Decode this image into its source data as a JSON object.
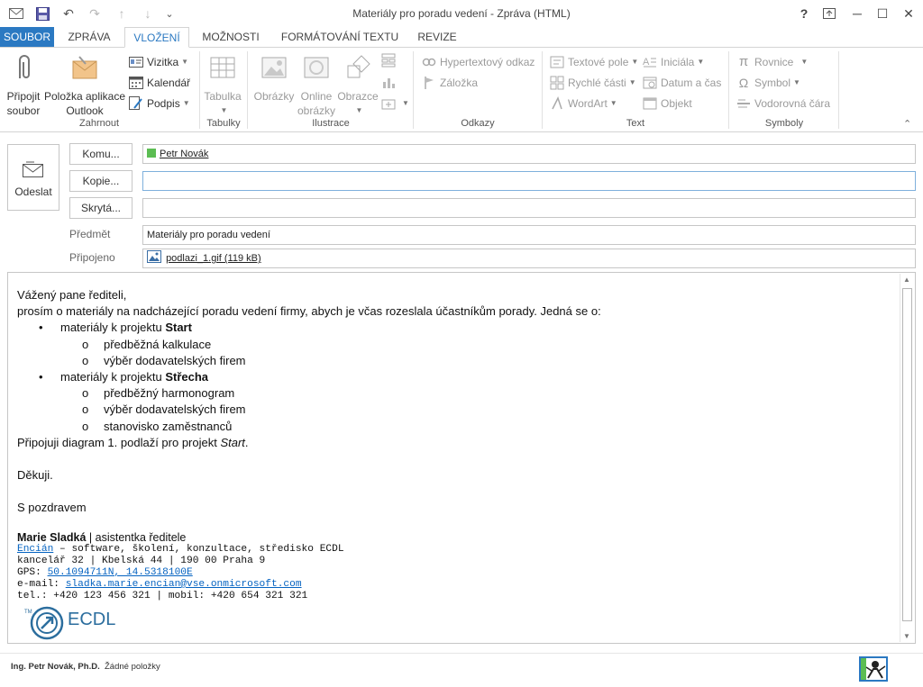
{
  "window": {
    "title": "Materiály pro poradu vedení - Zpráva (HTML)",
    "help": "?",
    "restore_glyph": "⊡",
    "minimize_glyph": "─",
    "maximize_glyph": "☐",
    "close_glyph": "✕"
  },
  "qat": {
    "save": "💾",
    "undo": "↶",
    "redo": "↷",
    "up": "↑",
    "down": "↓",
    "customize": "⌄"
  },
  "tabs": [
    "SOUBOR",
    "ZPRÁVA",
    "VLOŽENÍ",
    "MOŽNOSTI",
    "FORMÁTOVÁNÍ TEXTU",
    "REVIZE"
  ],
  "ribbon": {
    "groups": [
      "Zahrnout",
      "Tabulky",
      "Ilustrace",
      "Odkazy",
      "Text",
      "Symboly"
    ],
    "attach_file": [
      "Připojit",
      "soubor"
    ],
    "outlook_item": [
      "Položka aplikace",
      "Outlook"
    ],
    "business_card": "Vizitka",
    "calendar": "Kalendář",
    "signature": "Podpis",
    "table": "Tabulka",
    "pictures": "Obrázky",
    "online_pictures": [
      "Online",
      "obrázky"
    ],
    "shapes": "Obrazce",
    "hyperlink": "Hypertextový odkaz",
    "bookmark": "Záložka",
    "text_box": "Textové pole",
    "quick_parts": "Rychlé části",
    "wordart": "WordArt",
    "drop_cap": "Iniciála",
    "date_time": "Datum a čas",
    "object": "Objekt",
    "equation": "Rovnice",
    "symbol": "Symbol",
    "horizontal_line": "Vodorovná čára",
    "collapse_glyph": "⌃"
  },
  "compose": {
    "send_label": "Odeslat",
    "to_label": "Komu...",
    "cc_label": "Kopie...",
    "bcc_label": "Skrytá...",
    "subject_label": "Předmět",
    "attached_label": "Připojeno",
    "to_value": "Petr Novák",
    "cc_value": "",
    "bcc_value": "",
    "subject_value": "Materiály pro poradu vedení",
    "attachment": "podlazi_1.gif (119 kB)"
  },
  "body": {
    "greeting": "Vážený pane řediteli,",
    "request": "prosím o materiály na nadcházející poradu vedení firmy, abych je včas rozeslala účastníkům porady. Jedná se o:",
    "items": [
      {
        "prefix": "materiály k projektu ",
        "project": "Start",
        "subitems": [
          "předběžná kalkulace",
          "výběr dodavatelských firem"
        ]
      },
      {
        "prefix": "materiály k projektu ",
        "project": "Střecha",
        "subitems": [
          "předběžný harmonogram",
          "výběr dodavatelských firem",
          "stanovisko zaměstnanců"
        ]
      }
    ],
    "attach_note_prefix": "Připojuji diagram 1. podlaží pro projekt ",
    "attach_note_project": "Start",
    "attach_note_suffix": ".",
    "thanks": "Děkuji.",
    "regards": "S pozdravem"
  },
  "signature": {
    "name": "Marie Sladká",
    "role": " | asistentka ředitele",
    "company": "Encián",
    "company_desc": " – software, školení, konzultace, středisko ECDL",
    "office": "kancelář 32 | Kbelská 44 | 190 00 Praha 9",
    "gps_label": "GPS: ",
    "gps": "50.1094711N, 14.5318100E",
    "email_label": "e-mail: ",
    "email": "sladka.marie.encian@vse.onmicrosoft.com",
    "phones": "tel.: +420 123 456 321 | mobil: +420 654 321 321",
    "logo_text": "ECDL",
    "logo_tm": "TM"
  },
  "status": {
    "person": "Ing. Petr Novák, Ph.D.",
    "items": "Žádné položky"
  },
  "colors": {
    "accent": "#2b79c2",
    "link": "#0563c1",
    "presence": "#5cbd53"
  }
}
